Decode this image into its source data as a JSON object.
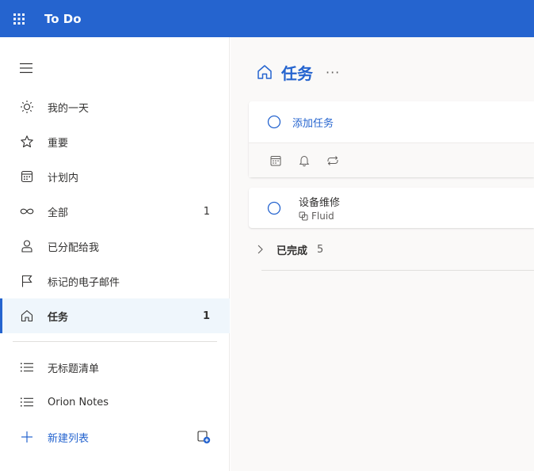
{
  "app": {
    "title": "To Do",
    "accent": "#2564cf",
    "waffle_icon": "waffle-icon"
  },
  "sidebar": {
    "menu_icon": "hamburger-icon",
    "items": [
      {
        "label": "我的一天",
        "icon": "sun-icon",
        "count": ""
      },
      {
        "label": "重要",
        "icon": "star-icon",
        "count": ""
      },
      {
        "label": "计划内",
        "icon": "calendar-icon",
        "count": ""
      },
      {
        "label": "全部",
        "icon": "infinity-icon",
        "count": "1"
      },
      {
        "label": "已分配给我",
        "icon": "person-icon",
        "count": ""
      },
      {
        "label": "标记的电子邮件",
        "icon": "flag-icon",
        "count": ""
      },
      {
        "label": "任务",
        "icon": "home-icon",
        "count": "1",
        "active": true
      }
    ],
    "lists": [
      {
        "label": "无标题清单",
        "icon": "list-icon"
      },
      {
        "label": "Orion Notes",
        "icon": "list-icon"
      }
    ],
    "new_list_label": "新建列表",
    "new_group_icon": "new-group-icon"
  },
  "main": {
    "title": "任务",
    "more_label": "···",
    "add_task_label": "添加任务",
    "tools": [
      "calendar-icon",
      "bell-icon",
      "repeat-icon"
    ],
    "tasks": [
      {
        "title": "设备维修",
        "source": "Fluid"
      }
    ],
    "completed": {
      "label": "已完成",
      "count": "5"
    }
  }
}
